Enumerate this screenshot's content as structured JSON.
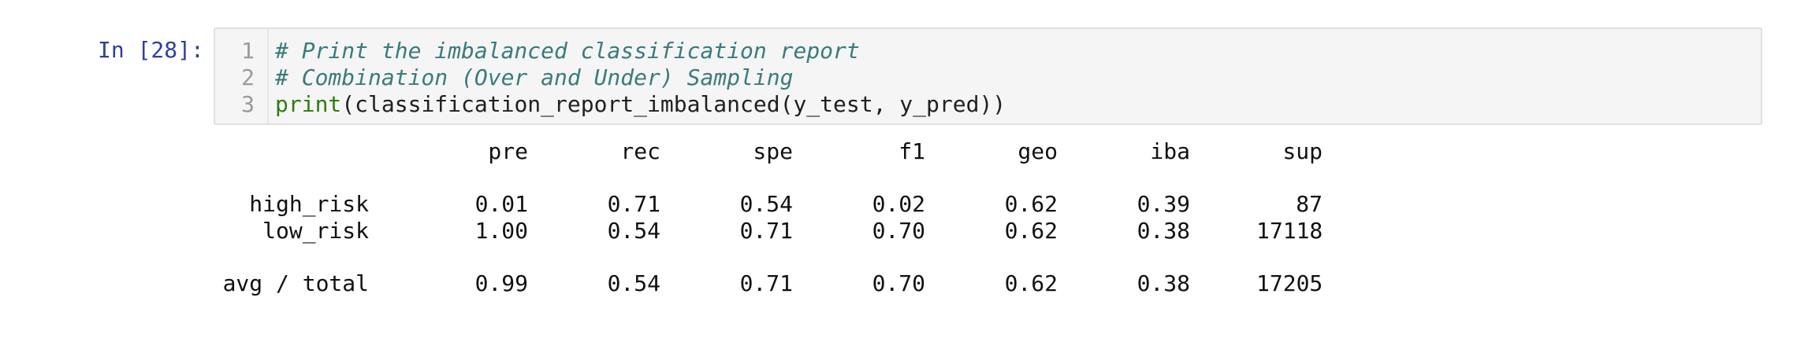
{
  "cell": {
    "prompt": "In [28]:",
    "code_lines": [
      {
        "number": "1",
        "text": "# Print the imbalanced classification report"
      },
      {
        "number": "2",
        "text": "# Combination (Over and Under) Sampling"
      },
      {
        "number": "3",
        "builtin": "print",
        "text": "(classification_report_imbalanced(y_test, y_pred))"
      }
    ]
  },
  "report": {
    "headers": [
      "pre",
      "rec",
      "spe",
      "f1",
      "geo",
      "iba",
      "sup"
    ],
    "rows": [
      {
        "label": "high_risk",
        "values": [
          "0.01",
          "0.71",
          "0.54",
          "0.02",
          "0.62",
          "0.39",
          "87"
        ]
      },
      {
        "label": "low_risk",
        "values": [
          "1.00",
          "0.54",
          "0.71",
          "0.70",
          "0.62",
          "0.38",
          "17118"
        ]
      },
      {
        "label": "avg / total",
        "values": [
          "0.99",
          "0.54",
          "0.71",
          "0.70",
          "0.62",
          "0.38",
          "17205"
        ]
      }
    ]
  },
  "colors": {
    "prompt": "#303f9f",
    "comment": "#3a7b7b",
    "builtin": "#2e7d0f",
    "editor_bg": "#f5f5f5"
  }
}
